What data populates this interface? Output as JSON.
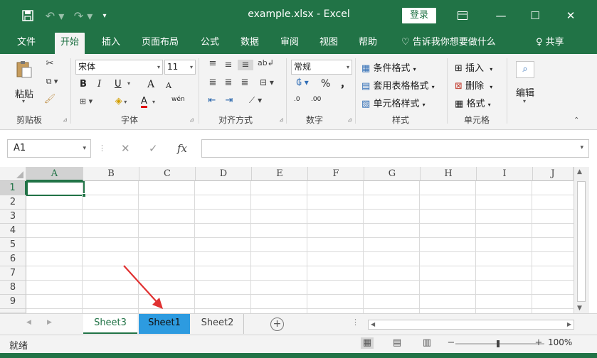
{
  "app": {
    "title": "example.xlsx  -  Excel",
    "login_label": "登录",
    "share_label": "共享",
    "search_hint": "告诉我你想要做什么",
    "accent_color": "#217346",
    "selected_tab_color": "#2d9be0",
    "annotation_color": "#e03131"
  },
  "tabs": [
    "文件",
    "开始",
    "插入",
    "页面布局",
    "公式",
    "数据",
    "审阅",
    "视图",
    "帮助"
  ],
  "active_tab": "开始",
  "ribbon": {
    "clipboard": {
      "label": "剪贴板",
      "paste": "粘贴"
    },
    "font": {
      "label": "字体",
      "name": "宋体",
      "size": "11",
      "bold": "B",
      "italic": "I",
      "underline": "U",
      "grow": "A",
      "shrink": "A",
      "phonetic": "wén"
    },
    "alignment": {
      "label": "对齐方式"
    },
    "number": {
      "label": "数字",
      "format": "常规",
      "percent": "%",
      "comma": "，",
      "inc_decimal": ".0",
      "dec_decimal": ".00"
    },
    "styles": {
      "label": "样式",
      "conditional": "条件格式",
      "table": "套用表格格式",
      "cell": "单元格样式"
    },
    "cells": {
      "label": "单元格",
      "insert": "插入",
      "delete": "删除",
      "format": "格式"
    },
    "editing": {
      "label": "编辑"
    }
  },
  "formula_bar": {
    "name_box": "A1",
    "fx": "fx",
    "value": ""
  },
  "grid": {
    "columns": [
      "A",
      "B",
      "C",
      "D",
      "E",
      "F",
      "G",
      "H",
      "I",
      "J"
    ],
    "rows": [
      "1",
      "2",
      "3",
      "4",
      "5",
      "6",
      "7",
      "8",
      "9"
    ],
    "active_cell": "A1"
  },
  "sheets": [
    {
      "name": "Sheet3",
      "state": "active"
    },
    {
      "name": "Sheet1",
      "state": "highlighted"
    },
    {
      "name": "Sheet2",
      "state": "normal"
    }
  ],
  "status": {
    "text": "就绪",
    "zoom": "100%"
  }
}
